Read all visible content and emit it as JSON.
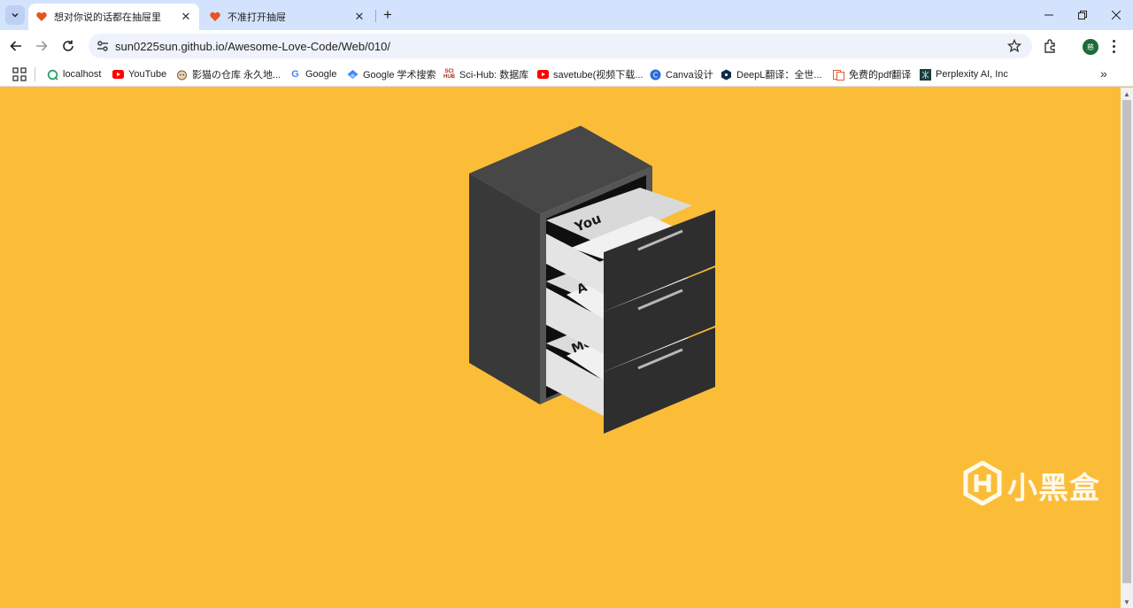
{
  "browser": {
    "tabs": [
      {
        "title": "想对你说的话都在抽屉里",
        "active": true
      },
      {
        "title": "不准打开抽屉",
        "active": false
      }
    ],
    "url": "sun0225sun.github.io/Awesome-Love-Code/Web/010/",
    "profile_initial": "慈"
  },
  "bookmarks": [
    {
      "label": "localhost",
      "icon": "localhost-icon"
    },
    {
      "label": "YouTube",
      "icon": "youtube-icon"
    },
    {
      "label": "影猫の仓库 永久地...",
      "icon": "cat-icon"
    },
    {
      "label": "Google",
      "icon": "google-icon"
    },
    {
      "label": "Google 学术搜索",
      "icon": "scholar-icon"
    },
    {
      "label": "Sci-Hub: 数据库",
      "icon": "scihub-icon"
    },
    {
      "label": "savetube(视频下载...",
      "icon": "youtube-icon"
    },
    {
      "label": "Canva设计",
      "icon": "canva-icon"
    },
    {
      "label": "DeepL翻译：全世...",
      "icon": "deepl-icon"
    },
    {
      "label": "免费的pdf翻译",
      "icon": "pdf-icon"
    },
    {
      "label": "Perplexity AI, Inc",
      "icon": "perplexity-icon"
    }
  ],
  "drawer_labels": [
    "You",
    "A",
    "Me"
  ],
  "watermark": "小黑盒",
  "colors": {
    "page_background": "#fbbd38",
    "cabinet_dark": "#333333",
    "drawer_inner": "#e8e8e8",
    "tab_strip": "#d3e3fd"
  }
}
